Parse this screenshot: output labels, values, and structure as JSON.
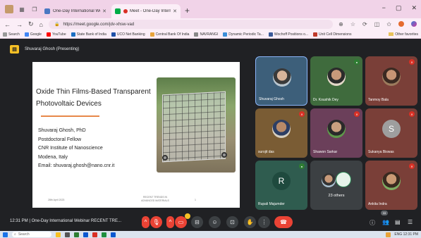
{
  "browser": {
    "tabs": [
      {
        "title": "One-Day International Webinar",
        "active": false
      },
      {
        "title": "Meet - One-Day Internation",
        "active": true
      }
    ],
    "url": "https://meet.google.com/jdv-xhsw-vad",
    "bookmarks": [
      "Search",
      "Google",
      "YouTube",
      "State Bank of India",
      "UCO Net Banking",
      "Central Bank Of India",
      "NAVRANGI",
      "Dynamic Periodic Ta...",
      "Wochoff Positions o...",
      "Unit Cell Dimensions"
    ],
    "bookmarks_other": "Other favorites"
  },
  "meet": {
    "presenter_label": "Shuvaraj Ghosh (Presenting)",
    "slide": {
      "title_line1": "Oxide Thin Films-Based Transparent",
      "title_line2": "Photovoltaic Devices",
      "body_lines": [
        "Shuvaraj Ghosh, PhD",
        "Postdoctoral Fellow",
        "CNR Institute of Nanoscience",
        "Modena, Italy",
        "Email: shuvaraj.ghosh@nano.cnr.it"
      ],
      "footer_left": "28th April 2023",
      "footer_center_line1": "RECENT TRENDS IN",
      "footer_center_line2": "ADVANCED MATERIALS",
      "footer_right": "1"
    },
    "participants": [
      {
        "name": "Shuvaraj Ghosh",
        "type": "photo",
        "color": "#3d5f7a"
      },
      {
        "name": "Dr. Koushik Dey",
        "type": "photo",
        "color": "#3f6b3d"
      },
      {
        "name": "Tanmoy Bala",
        "type": "photo",
        "color": "#7a3f38"
      },
      {
        "name": "surojit das",
        "type": "photo",
        "color": "#7a5c34"
      },
      {
        "name": "Shawon Sarkar",
        "type": "photo",
        "color": "#6b3f5a"
      },
      {
        "name": "Sukanya Biswas",
        "type": "letter",
        "letter": "S",
        "color": "#7a3f38"
      },
      {
        "name": "Rupali Majumder",
        "type": "letter",
        "letter": "R",
        "color": "#2f5c4f"
      },
      {
        "name": "23 others",
        "type": "others",
        "color": "#3c4043"
      },
      {
        "name": "Ankita Indra",
        "type": "photo",
        "color": "#7a3f38"
      }
    ],
    "meeting_time": "12:31 PM",
    "meeting_title": "One-Day International Webinar RECENT TRE...",
    "people_count": "33"
  },
  "taskbar": {
    "search_placeholder": "Search",
    "tray_text": "ENG  12:31 PM"
  },
  "colors": {
    "meet_bg": "#202124",
    "leave_red": "#ea4335",
    "accent_yellow": "#f6c025",
    "tab_pink": "#f1d3e8"
  }
}
